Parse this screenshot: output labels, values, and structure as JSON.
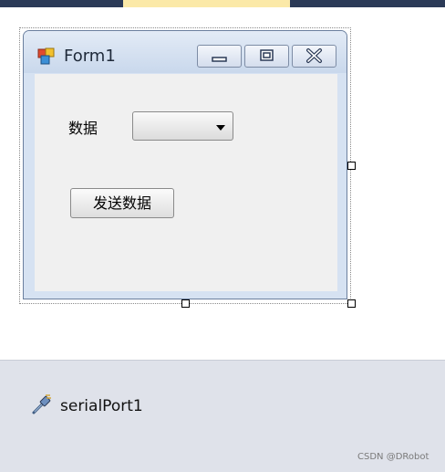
{
  "form": {
    "title": "Form1",
    "data_label": "数据",
    "combo_value": "",
    "send_button_label": "发送数据"
  },
  "component_tray": {
    "components": [
      {
        "name": "serialPort1",
        "icon": "serial-port-icon"
      }
    ]
  },
  "watermark": "CSDN @DRobot",
  "colors": {
    "titlebar": "#c9d8ec",
    "client": "#f0f0f0",
    "tray": "#dfe2ea"
  }
}
